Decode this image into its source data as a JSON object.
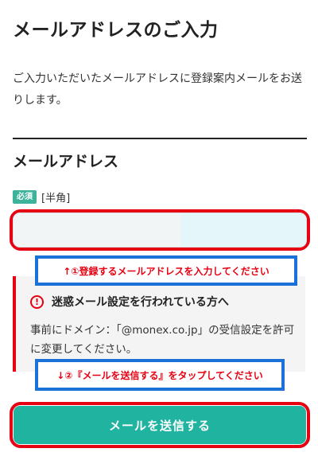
{
  "header": {
    "title": "メールアドレスのご入力"
  },
  "intro": {
    "text": "ご入力いただいたメールアドレスに登録案内メールをお送りします。"
  },
  "email_section": {
    "heading": "メールアドレス",
    "required_badge": "必須",
    "input_hint": "[半角]",
    "input_value": "",
    "input_placeholder": ""
  },
  "annotations": {
    "step1": "↑①登録するメールアドレスを入力してください",
    "step2": "↓②『メールを送信する』をタップしてください"
  },
  "notice": {
    "icon": "alert-circle-icon",
    "title": "迷惑メール設定を行われている方へ",
    "body": "事前にドメイン：「@monex.co.jp」の受信設定を許可に変更してください。"
  },
  "actions": {
    "submit_label": "メールを送信する"
  },
  "colors": {
    "accent": "#1fb3a0",
    "badge": "#3cb39a",
    "highlight_red": "#e60012",
    "annotation_blue": "#1a72d9"
  }
}
